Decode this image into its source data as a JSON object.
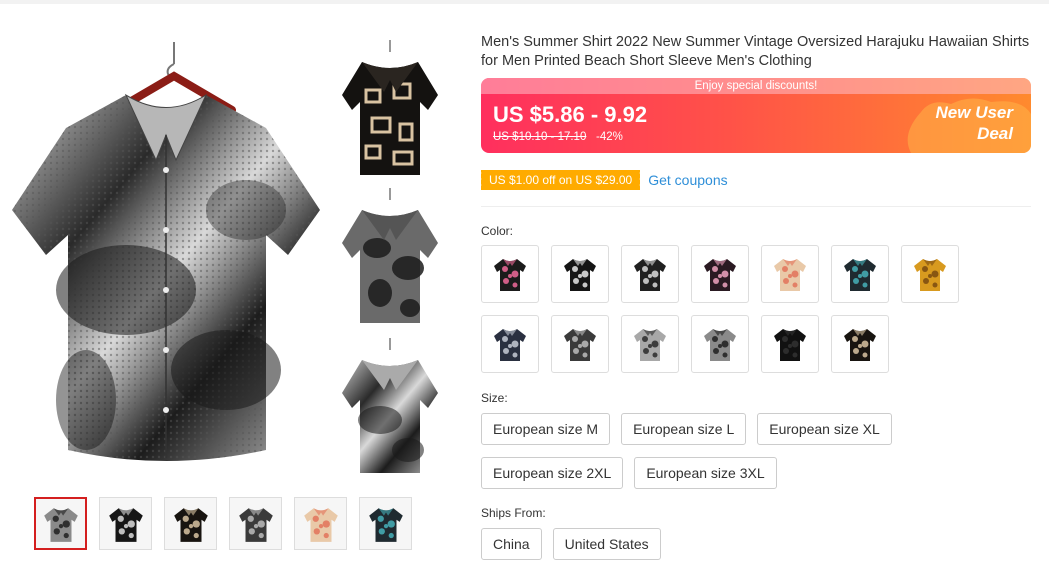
{
  "product": {
    "title": "Men's Summer Shirt 2022 New Summer Vintage Oversized Harajuku Hawaiian Shirts for Men Printed Beach Short Sleeve Men's Clothing"
  },
  "price": {
    "banner_text": "Enjoy special discounts!",
    "current": "US $5.86 - 9.92",
    "original": "US $10.10 - 17.10",
    "discount": "-42%",
    "deal_line1": "New User",
    "deal_line2": "Deal"
  },
  "coupon": {
    "tag": "US $1.00 off on US $29.00",
    "link": "Get coupons"
  },
  "color": {
    "label": "Color:",
    "swatches": [
      {
        "name": "black-floral-pink",
        "base": "#1b1b1b",
        "accent": "#f06a9a"
      },
      {
        "name": "black-white-leaf",
        "base": "#151515",
        "accent": "#e8e8e8"
      },
      {
        "name": "black-white-floral",
        "base": "#202020",
        "accent": "#dcdcdc"
      },
      {
        "name": "pink-black-floral",
        "base": "#2a1a22",
        "accent": "#f0a4c0"
      },
      {
        "name": "beige-coral",
        "base": "#e9c9a8",
        "accent": "#e2735a"
      },
      {
        "name": "teal-tropical",
        "base": "#1f2a30",
        "accent": "#46b0b8"
      },
      {
        "name": "mustard-print",
        "base": "#d89a1f",
        "accent": "#7a4a10"
      },
      {
        "name": "navy-white-print",
        "base": "#2a3040",
        "accent": "#c7cbd6"
      },
      {
        "name": "grey-black-floral",
        "base": "#3a3a3a",
        "accent": "#bdbdbd"
      },
      {
        "name": "white-black-leaf",
        "base": "#a8a8a8",
        "accent": "#2a2a2a"
      },
      {
        "name": "grey-tie-dye",
        "base": "#8a8a8a",
        "accent": "#1e1e1e"
      },
      {
        "name": "solid-black",
        "base": "#111111",
        "accent": "#333333"
      },
      {
        "name": "black-geometric",
        "base": "#181410",
        "accent": "#d9c3a2"
      }
    ]
  },
  "size": {
    "label": "Size:",
    "options": [
      "European size M",
      "European size L",
      "European size XL",
      "European size 2XL",
      "European size 3XL"
    ]
  },
  "ships_from": {
    "label": "Ships From:",
    "options": [
      "China",
      "United States"
    ]
  },
  "gallery": {
    "thumbnails": [
      {
        "name": "thumb-tie-dye-set",
        "base": "#8a8a8a",
        "accent": "#1e1e1e"
      },
      {
        "name": "thumb-black-white-leaf",
        "base": "#161616",
        "accent": "#dcdcdc"
      },
      {
        "name": "thumb-black-geometric",
        "base": "#181410",
        "accent": "#d9c3a2"
      },
      {
        "name": "thumb-grey-floral",
        "base": "#3a3a3a",
        "accent": "#bdbdbd"
      },
      {
        "name": "thumb-beige-coral",
        "base": "#e9c9a8",
        "accent": "#e2735a"
      },
      {
        "name": "thumb-teal-tropical-set",
        "base": "#1f2a30",
        "accent": "#46b0b8"
      }
    ]
  },
  "colors": {
    "accent_red": "#d41f1f",
    "coupon_orange": "#ffab00",
    "link_blue": "#2f8fd8"
  }
}
